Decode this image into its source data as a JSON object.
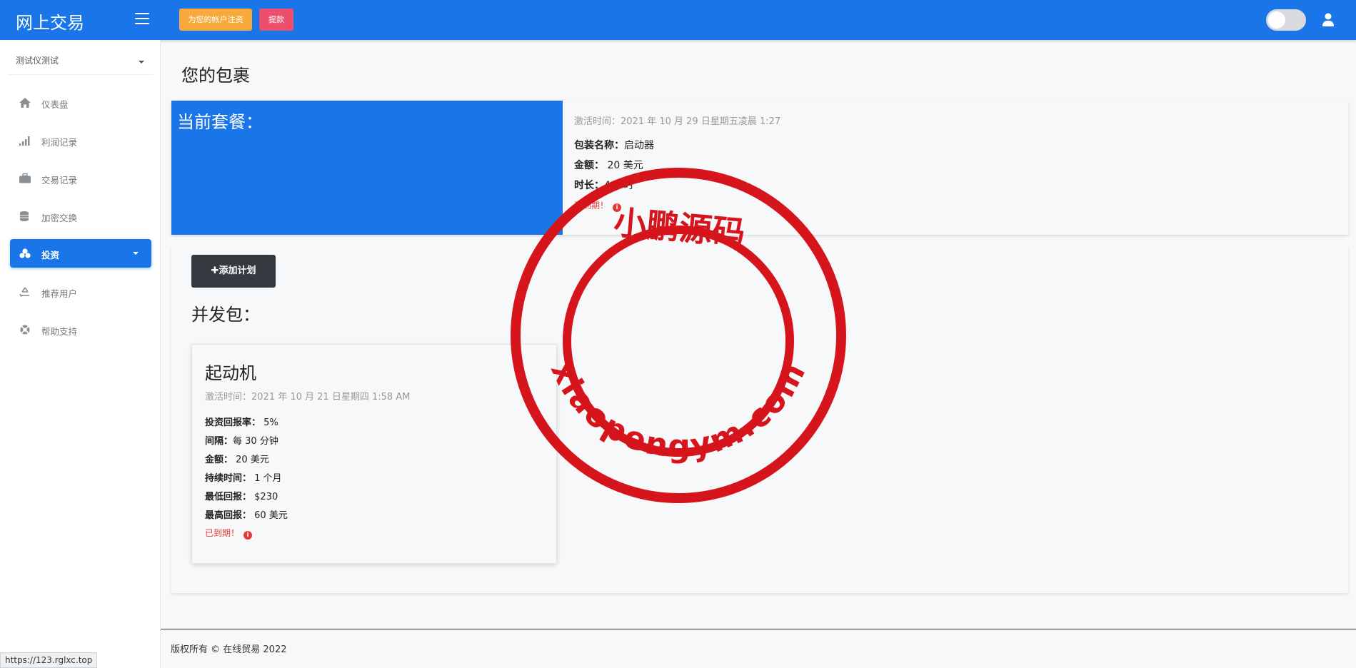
{
  "app": {
    "brand": "网上交易"
  },
  "header": {
    "deposit_label": "为您的帐户注资",
    "withdraw_label": "提款",
    "theme_toggle": "off",
    "icons": {
      "menu": "hamburger-icon",
      "user": "user-icon"
    }
  },
  "sidebar": {
    "account_name": "测试仪测试",
    "items": [
      {
        "label": "仪表盘",
        "icon": "home-icon"
      },
      {
        "label": "利润记录",
        "icon": "signal-bars-icon"
      },
      {
        "label": "交易记录",
        "icon": "briefcase-icon"
      },
      {
        "label": "加密交换",
        "icon": "coins-icon"
      },
      {
        "label": "投资",
        "icon": "cubes-icon",
        "active": true
      },
      {
        "label": "推荐用户",
        "icon": "recycle-icon"
      },
      {
        "label": "帮助支持",
        "icon": "lifebuoy-icon"
      }
    ]
  },
  "main": {
    "page_title": "您的包裹",
    "current_package": {
      "heading": "当前套餐：",
      "activated": "激活时间：2021 年 10 月 29 日星期五凌晨 1:27",
      "name_label": "包装名称：",
      "name_value": "启动器",
      "amount_label": "金额：",
      "amount_value": "20 美元",
      "duration_label": "时长：",
      "duration_value": "4 小时",
      "expired_label": "已到期！"
    },
    "plans": {
      "add_button": "添加计划",
      "title": "并发包：",
      "cards": [
        {
          "name": "起动机",
          "activated": "激活时间：2021 年 10 月 21 日星期四 1:58 AM",
          "roi_label": "投资回报率：",
          "roi_value": "5%",
          "interval_label": "间隔：",
          "interval_value": "每 30 分钟",
          "amount_label": "金额：",
          "amount_value": "20 美元",
          "duration_label": "持续时间：",
          "duration_value": "1 个月",
          "min_return_label": "最低回报：",
          "min_return_value": "$230",
          "max_return_label": "最高回报：",
          "max_return_value": "60 美元",
          "expired_label": "已到期！"
        }
      ]
    }
  },
  "footer": {
    "copyright": "版权所有 © 在线贸易 2022"
  },
  "status_bar": {
    "url": "https://123.rglxc.top"
  },
  "watermark": {
    "top_text": "小鹏源码",
    "bottom_text": "xiaopengym.com",
    "color": "#d6141c"
  },
  "colors": {
    "primary": "#1a75e8",
    "deposit": "#f8a93c",
    "withdraw": "#ec4e6b",
    "expired": "#e53935",
    "dark_button": "#343a40"
  }
}
